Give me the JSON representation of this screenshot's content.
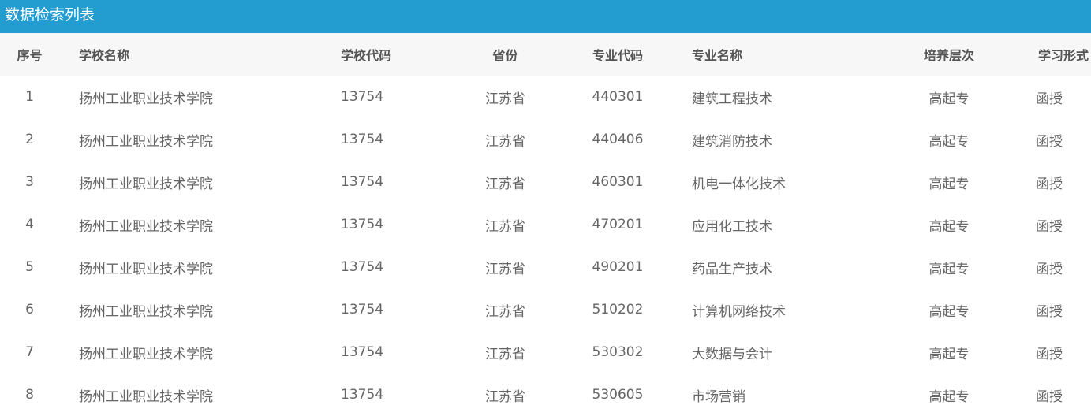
{
  "panel": {
    "title": "数据检索列表"
  },
  "table": {
    "headers": {
      "index": "序号",
      "school_name": "学校名称",
      "school_code": "学校代码",
      "province": "省份",
      "major_code": "专业代码",
      "major_name": "专业名称",
      "level": "培养层次",
      "study_form": "学习形式"
    },
    "rows": [
      {
        "index": "1",
        "school_name": "扬州工业职业技术学院",
        "school_code": "13754",
        "province": "江苏省",
        "major_code": "440301",
        "major_name": "建筑工程技术",
        "level": "高起专",
        "study_form": "函授"
      },
      {
        "index": "2",
        "school_name": "扬州工业职业技术学院",
        "school_code": "13754",
        "province": "江苏省",
        "major_code": "440406",
        "major_name": "建筑消防技术",
        "level": "高起专",
        "study_form": "函授"
      },
      {
        "index": "3",
        "school_name": "扬州工业职业技术学院",
        "school_code": "13754",
        "province": "江苏省",
        "major_code": "460301",
        "major_name": "机电一体化技术",
        "level": "高起专",
        "study_form": "函授"
      },
      {
        "index": "4",
        "school_name": "扬州工业职业技术学院",
        "school_code": "13754",
        "province": "江苏省",
        "major_code": "470201",
        "major_name": "应用化工技术",
        "level": "高起专",
        "study_form": "函授"
      },
      {
        "index": "5",
        "school_name": "扬州工业职业技术学院",
        "school_code": "13754",
        "province": "江苏省",
        "major_code": "490201",
        "major_name": "药品生产技术",
        "level": "高起专",
        "study_form": "函授"
      },
      {
        "index": "6",
        "school_name": "扬州工业职业技术学院",
        "school_code": "13754",
        "province": "江苏省",
        "major_code": "510202",
        "major_name": "计算机网络技术",
        "level": "高起专",
        "study_form": "函授"
      },
      {
        "index": "7",
        "school_name": "扬州工业职业技术学院",
        "school_code": "13754",
        "province": "江苏省",
        "major_code": "530302",
        "major_name": "大数据与会计",
        "level": "高起专",
        "study_form": "函授"
      },
      {
        "index": "8",
        "school_name": "扬州工业职业技术学院",
        "school_code": "13754",
        "province": "江苏省",
        "major_code": "530605",
        "major_name": "市场营销",
        "level": "高起专",
        "study_form": "函授"
      }
    ]
  },
  "colors": {
    "header_bar": "#239ccf",
    "table_head_bg": "#f7f7f7"
  }
}
